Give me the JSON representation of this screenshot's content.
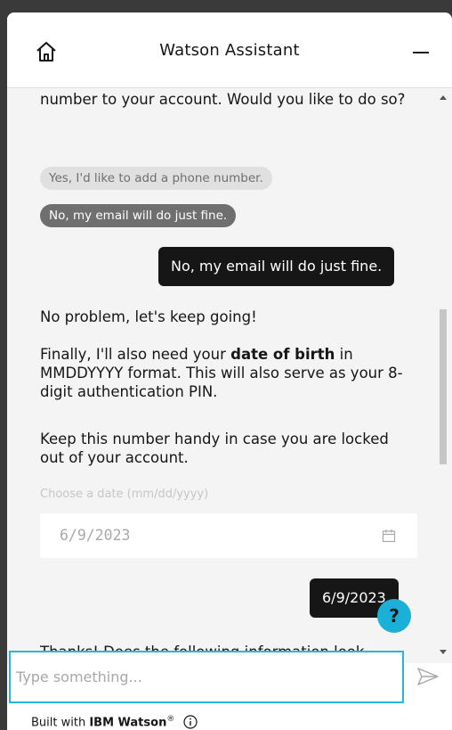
{
  "header": {
    "title": "Watson Assistant"
  },
  "messages": {
    "bot_1": "number to your account. Would you like to do so?",
    "chip_1": "Yes, I'd like to add a phone number.",
    "chip_2": "No, my email will do just fine.",
    "user_1": "No, my email will do just fine.",
    "bot_2": "No problem, let's keep going!",
    "bot_3_pre": "Finally, I'll also need your ",
    "bot_3_bold": "date of birth",
    "bot_3_post": " in MMDDYYYY format. This will also serve as your 8-digit authentication PIN.",
    "bot_4": "Keep this number handy in case you are locked out of your account.",
    "date_label": "Choose a date (mm/dd/yyyy)",
    "date_value": "6/9/2023",
    "user_2": "6/9/2023",
    "bot_5": "Thanks! Does the following information look"
  },
  "help_fab": {
    "label": "?"
  },
  "input": {
    "placeholder": "Type something..."
  },
  "footer": {
    "prefix": "Built with ",
    "brand": "IBM Watson",
    "mark": "®"
  },
  "colors": {
    "accent": "#2eb4d4",
    "help": "#1ab0d8",
    "user_bubble": "#161616",
    "chat_bg": "#f4f4f4"
  },
  "icons": [
    "home-icon",
    "minimize-icon",
    "calendar-icon",
    "send-icon",
    "info-icon",
    "help-icon"
  ]
}
